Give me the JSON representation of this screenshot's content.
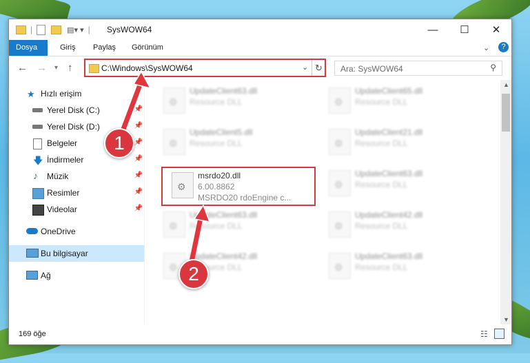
{
  "window": {
    "title": "SysWOW64"
  },
  "ribbon": {
    "tabs": [
      "Dosya",
      "Giriş",
      "Paylaş",
      "Görünüm"
    ]
  },
  "address": {
    "path": "C:\\Windows\\SysWOW64"
  },
  "search": {
    "placeholder": "Ara: SysWOW64"
  },
  "sidebar": {
    "items": [
      {
        "label": "Hızlı erişim"
      },
      {
        "label": "Yerel Disk (C:)"
      },
      {
        "label": "Yerel Disk (D:)"
      },
      {
        "label": "Belgeler"
      },
      {
        "label": "İndirmeler"
      },
      {
        "label": "Müzik"
      },
      {
        "label": "Resimler"
      },
      {
        "label": "Videolar"
      },
      {
        "label": "OneDrive"
      },
      {
        "label": "Bu bilgisayar"
      },
      {
        "label": "Ağ"
      }
    ]
  },
  "files": {
    "left": [
      {
        "name": "UpdateClient63.dll",
        "type": "Resource DLL"
      },
      {
        "name": "UpdateClient5.dll",
        "type": "Resource DLL"
      },
      {
        "name": "UpdateClient63.dll",
        "type": "Resource DLL"
      },
      {
        "name": "UpdateClient42.dll",
        "type": "Resource DLL"
      }
    ],
    "right": [
      {
        "name": "UpdateClient65.dll",
        "type": "Resource DLL"
      },
      {
        "name": "UpdateClient21.dll",
        "type": "Resource DLL"
      },
      {
        "name": "UpdateClient63.dll",
        "type": "Resource DLL"
      },
      {
        "name": "UpdateClient42.dll",
        "type": "Resource DLL"
      },
      {
        "name": "UpdateClient63.dll",
        "type": "Resource DLL"
      }
    ],
    "highlighted": {
      "name": "msrdo20.dll",
      "version": "6.00.8862",
      "description": "MSRDO20 rdoEngine c..."
    }
  },
  "status": {
    "count": "169 öğe"
  },
  "annotations": {
    "one": "1",
    "two": "2"
  }
}
